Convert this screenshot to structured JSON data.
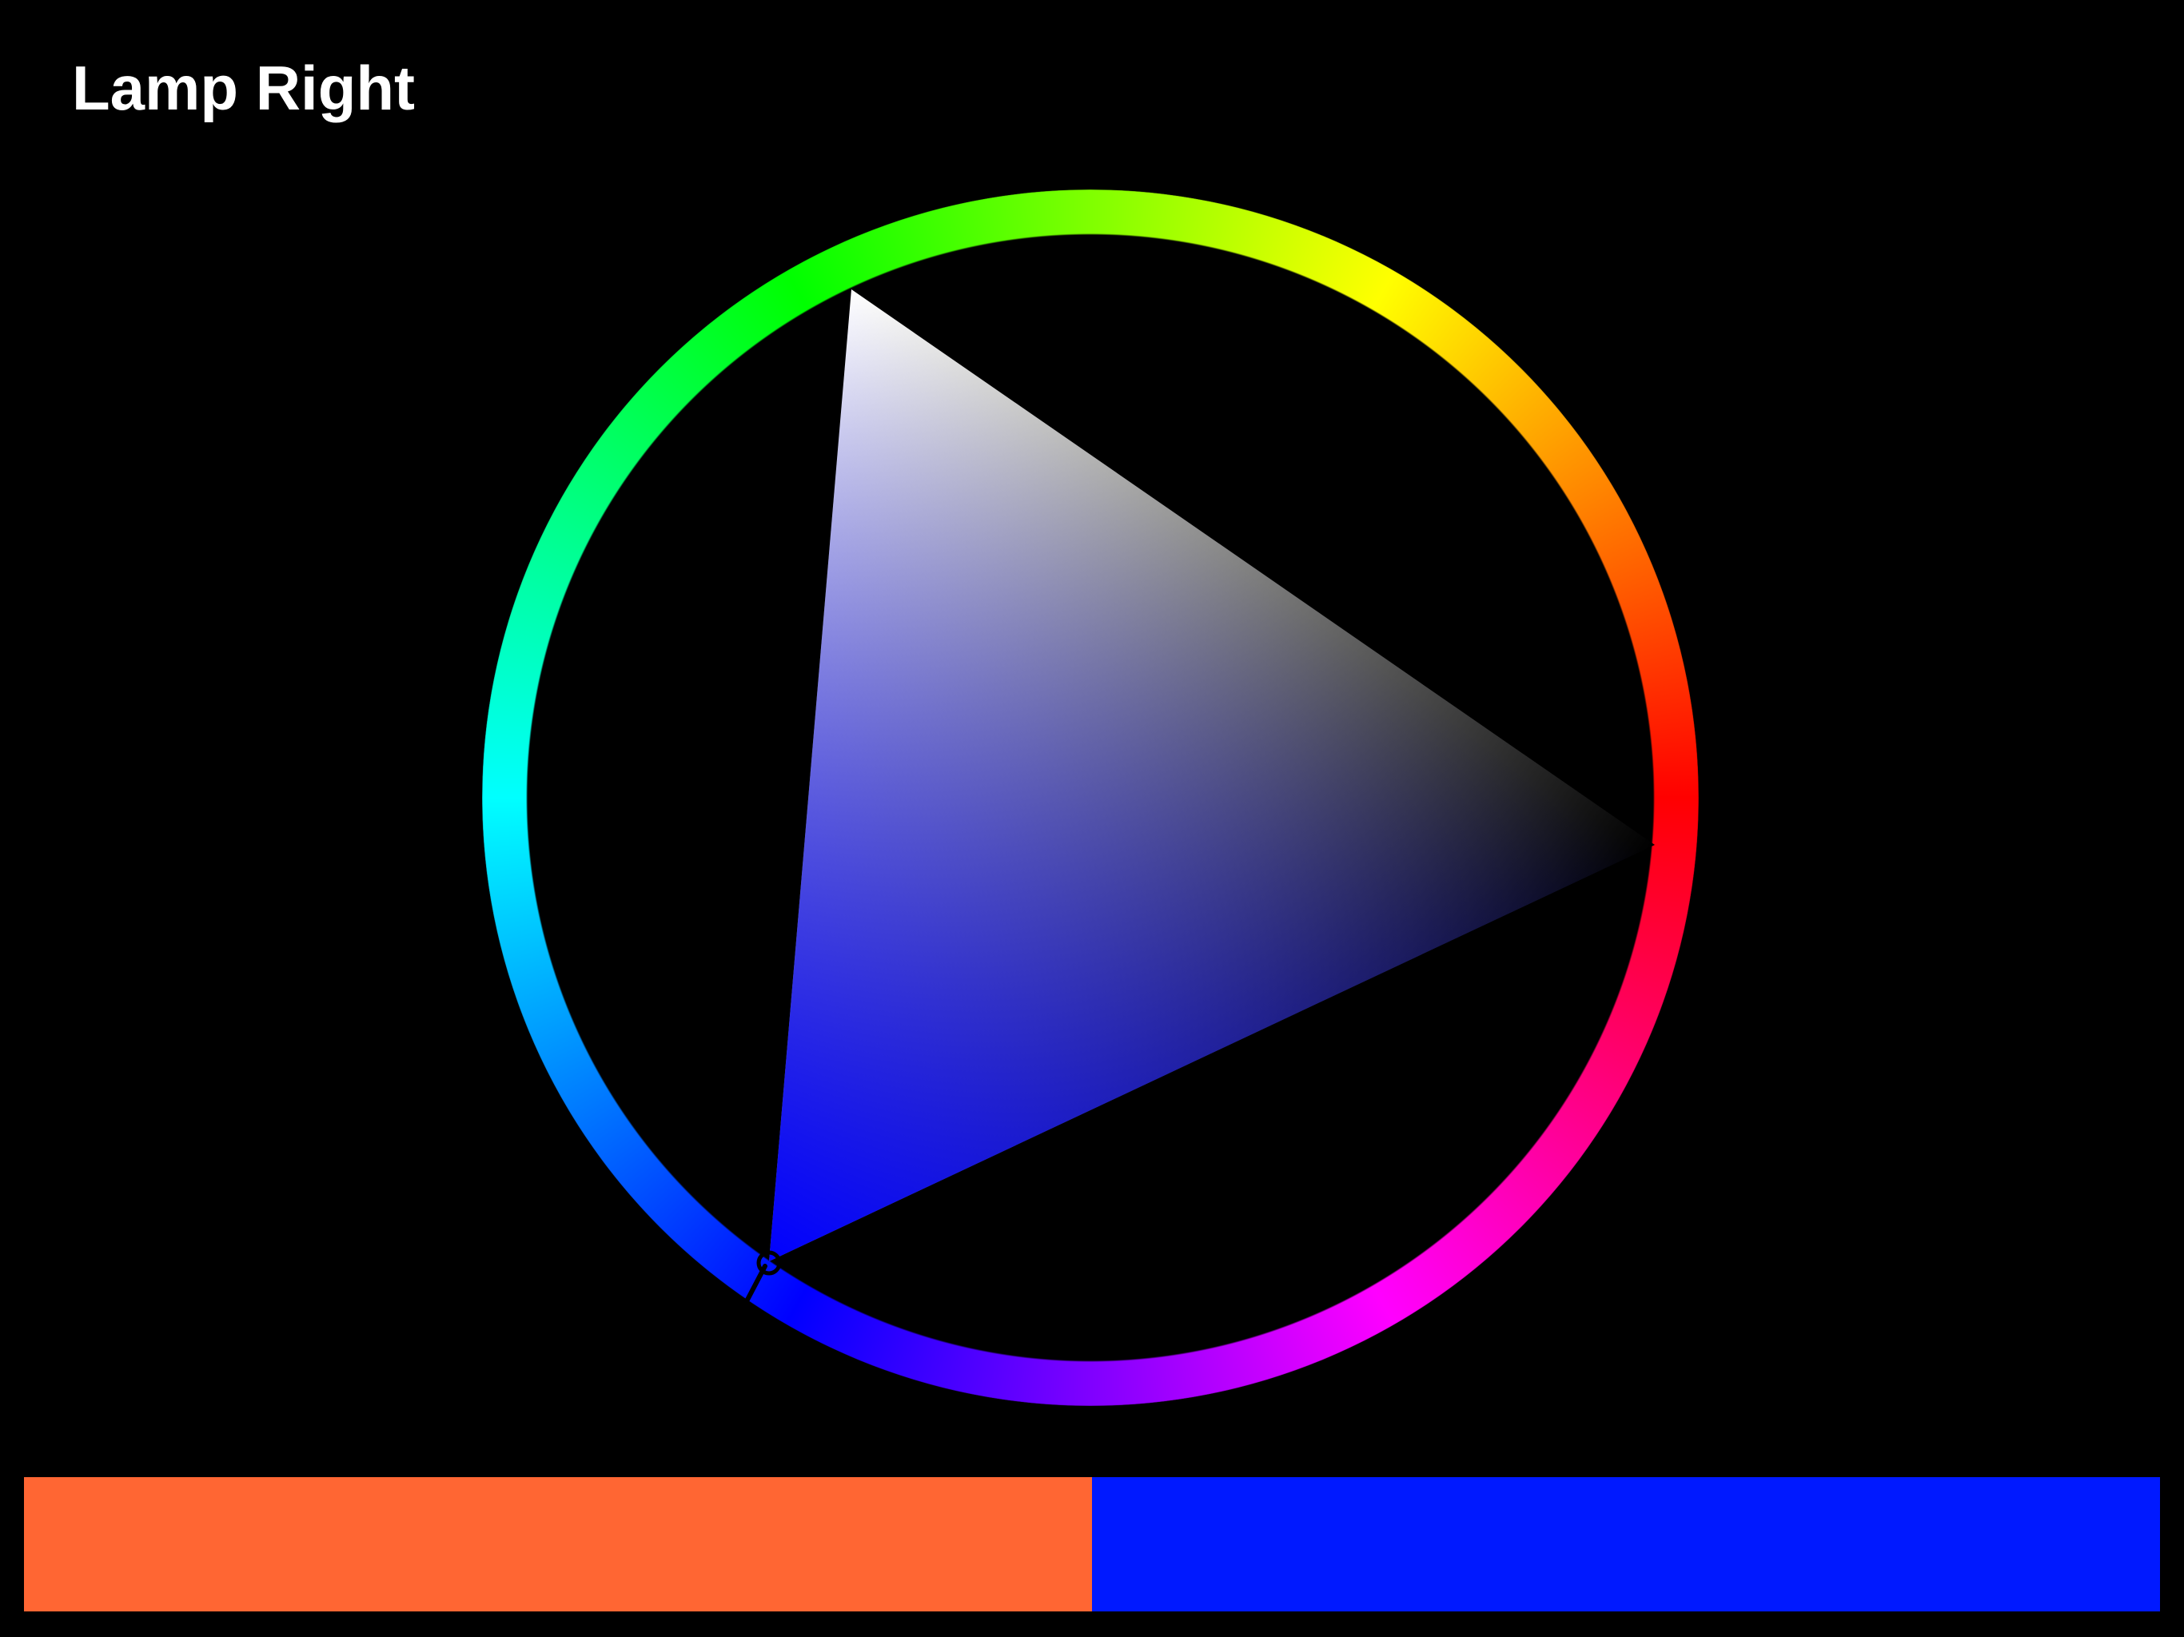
{
  "header": {
    "title": "Lamp Right"
  },
  "color_picker": {
    "hue_ring": {
      "name": "hue-wheel"
    },
    "triangle": {
      "hue_color": "#0000ff"
    },
    "selected_hue_color": "#0000ff"
  },
  "swatches": {
    "previous_color": "#ff6633",
    "current_color": "#0019ff"
  }
}
